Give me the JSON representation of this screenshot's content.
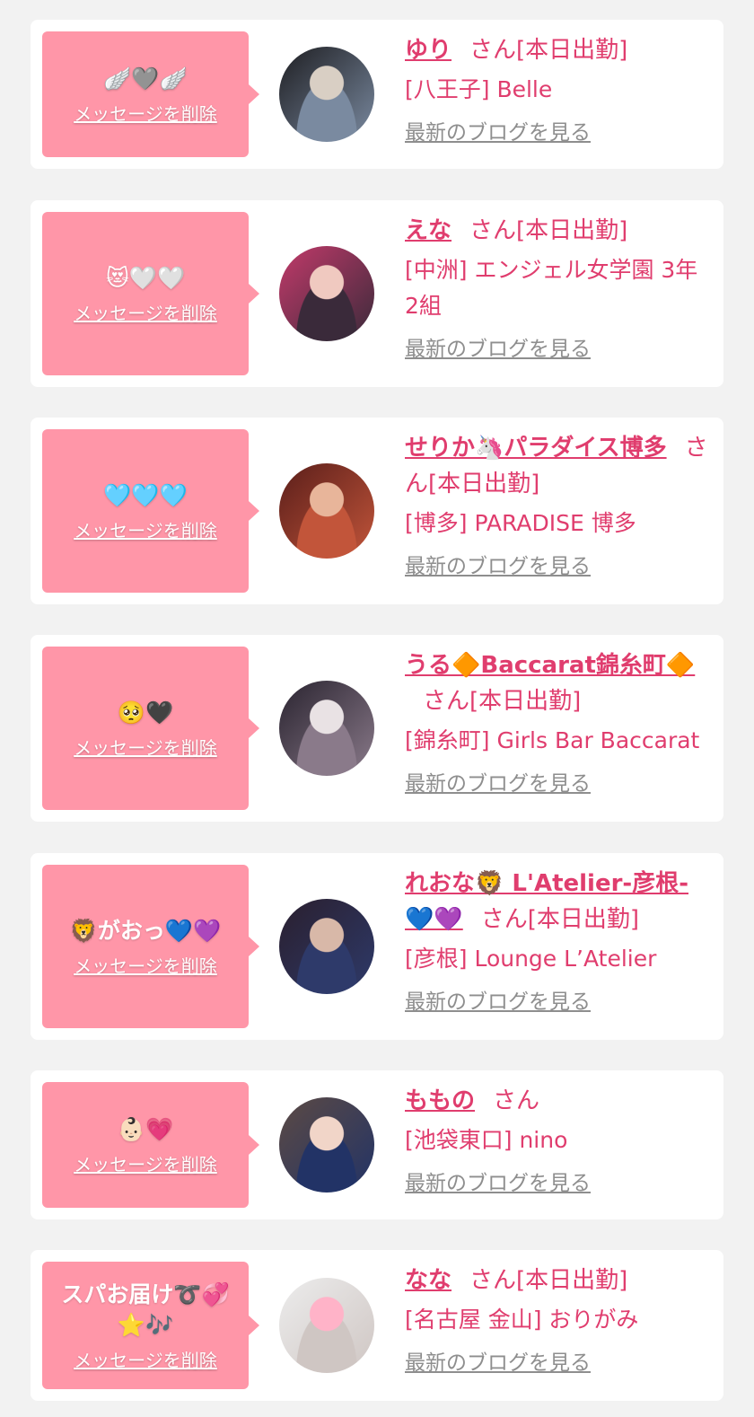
{
  "labels": {
    "delete": "メッセージを削除",
    "blog": "最新のブログを見る"
  },
  "entries": [
    {
      "message": "🪽🩶🪽",
      "name": "ゆり",
      "suffix": "さん[本日出勤]",
      "shop": "[八王子] Belle",
      "avatar_colors": [
        "#1e1e22",
        "#7a8aa0",
        "#d9cfc4"
      ]
    },
    {
      "message": "😻🤍🤍",
      "name": "えな",
      "suffix": "さん[本日出勤]",
      "shop": "[中洲] エンジェル女学園 3年2組",
      "avatar_colors": [
        "#c23a6a",
        "#3a2a3a",
        "#f0c9c0"
      ]
    },
    {
      "message": "🩵🩵🩵",
      "name": "せりか🦄パラダイス博多",
      "suffix": "さん[本日出勤]",
      "shop": "[博多] PARADISE 博多",
      "avatar_colors": [
        "#5a1e1a",
        "#c2553a",
        "#e8b59a"
      ]
    },
    {
      "message": "🥺🖤",
      "name": "うる🔶Baccarat錦糸町🔶",
      "suffix": "さん[本日出勤]",
      "shop": "[錦糸町] Girls Bar Baccarat",
      "avatar_colors": [
        "#2a2430",
        "#8a7a8a",
        "#e9e2e4"
      ]
    },
    {
      "message": "🦁がおっ💙💜",
      "name": "れおな🦁 L'Atelier-彦根-💙💜",
      "suffix": "さん[本日出勤]",
      "shop": "[彦根] Lounge L’Atelier",
      "avatar_colors": [
        "#2a1f2e",
        "#2e3a6a",
        "#d8b8a8"
      ]
    },
    {
      "message": "👶🏻💗",
      "name": "ももの",
      "suffix": "さん",
      "shop": "[池袋東口] nino",
      "avatar_colors": [
        "#5c4a44",
        "#223366",
        "#f1d5c8"
      ]
    },
    {
      "message": "スパお届け➰💞\n⭐️🎶",
      "name": "なな",
      "suffix": "さん[本日出勤]",
      "shop": "[名古屋 金山] おりがみ",
      "avatar_colors": [
        "#ececec",
        "#cfc6c3",
        "#ffb3c8"
      ]
    }
  ]
}
